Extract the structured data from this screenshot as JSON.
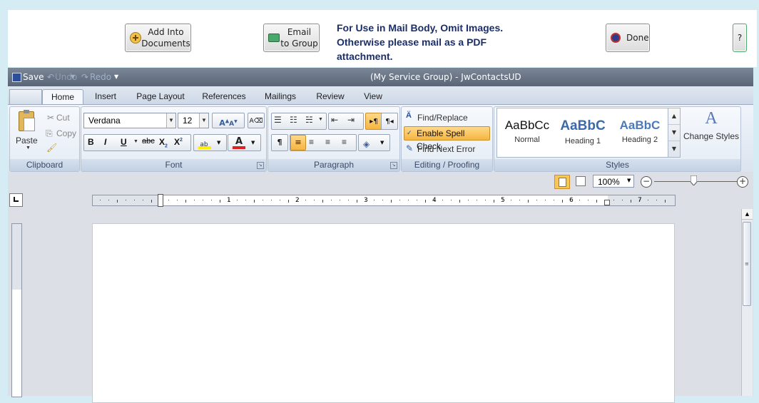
{
  "top_panel": {
    "add_into_documents": "Add Into\nDocuments",
    "add_into_documents_line1": "Add Into",
    "add_into_documents_line2": "Documents",
    "email_line1": "Email",
    "email_line2": "to Group",
    "notice_line1": "For Use in Mail Body, Omit Images.",
    "notice_line2": "Otherwise please mail as a PDF",
    "notice_line3": "attachment.",
    "done_label": "Done",
    "help_label": "?"
  },
  "titlebar": {
    "save_label": "Save",
    "undo_label": "Undo",
    "redo_label": "Redo",
    "title": "(My Service Group)  - JwContactsUD"
  },
  "tabs": [
    {
      "label": "Home"
    },
    {
      "label": "Insert"
    },
    {
      "label": "Page Layout"
    },
    {
      "label": "References"
    },
    {
      "label": "Mailings"
    },
    {
      "label": "Review"
    },
    {
      "label": "View"
    }
  ],
  "clipboard": {
    "paste_label": "Paste",
    "cut_label": "Cut",
    "copy_label": "Copy",
    "group_label": "Clipboard"
  },
  "font": {
    "family": "Verdana",
    "size": "12",
    "group_label": "Font",
    "bold": "B",
    "italic": "I",
    "underline": "U",
    "strike": "abc",
    "subscript": "X",
    "superscript": "X"
  },
  "paragraph": {
    "group_label": "Paragraph",
    "pilcrow": "¶"
  },
  "editing": {
    "find_replace": "Find/Replace",
    "spell_check": "Enable Spell Check",
    "find_next_error": "Find Next Error",
    "group_label": "Editing / Proofing"
  },
  "styles": {
    "items": [
      {
        "sample": "AaBbCc",
        "name": "Normal"
      },
      {
        "sample": "AaBbC",
        "name": "Heading 1"
      },
      {
        "sample": "AaBbC",
        "name": "Heading 2"
      }
    ],
    "change_styles": "Change Styles",
    "group_label": "Styles"
  },
  "status": {
    "zoom": "100%"
  },
  "ruler": {
    "numbers": [
      "1",
      "2",
      "3",
      "4",
      "5",
      "6",
      "7"
    ]
  },
  "colors": {
    "accent_orange": "#f6b540",
    "notice_text": "#1a2e6b",
    "titlebar": "#5a6577"
  }
}
